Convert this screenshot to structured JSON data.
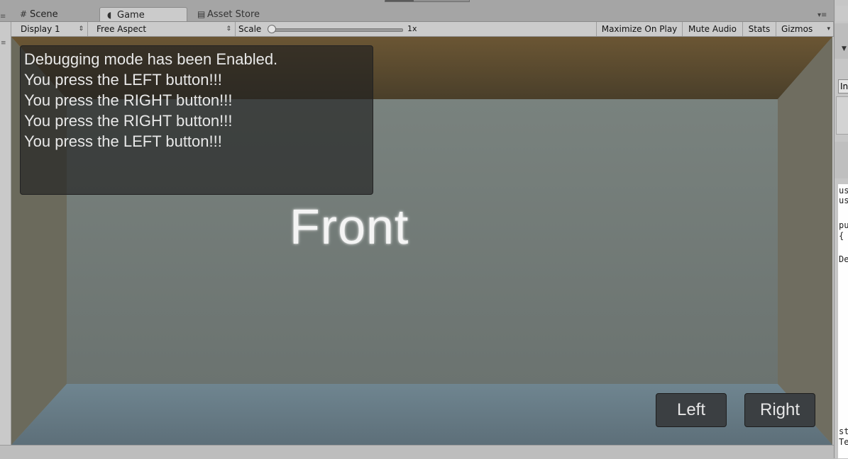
{
  "tabs": {
    "scene": {
      "icon": "grid-icon",
      "label": "Scene"
    },
    "game": {
      "icon": "pacman-icon",
      "label": "Game"
    },
    "asset_store": {
      "icon": "shopping-bag-icon",
      "label": "Asset Store"
    }
  },
  "toolbar": {
    "display": "Display 1",
    "aspect": "Free Aspect",
    "scale_label": "Scale",
    "scale_value": "1x",
    "scale_level": 0,
    "maximize": "Maximize On Play",
    "mute": "Mute Audio",
    "stats": "Stats",
    "gizmos": "Gizmos"
  },
  "game_view": {
    "debug_lines": [
      "Debugging mode has been Enabled.",
      "You press the LEFT button!!!",
      "You press the RIGHT button!!!",
      "You press the RIGHT button!!!",
      "You press the LEFT button!!!"
    ],
    "front_text": "Front",
    "left_button": "Left",
    "right_button": "Right"
  },
  "right_panel": {
    "field_text": "In",
    "code_fragments": [
      "us",
      "us",
      "pu",
      "{",
      "De",
      "st",
      "Te"
    ]
  }
}
